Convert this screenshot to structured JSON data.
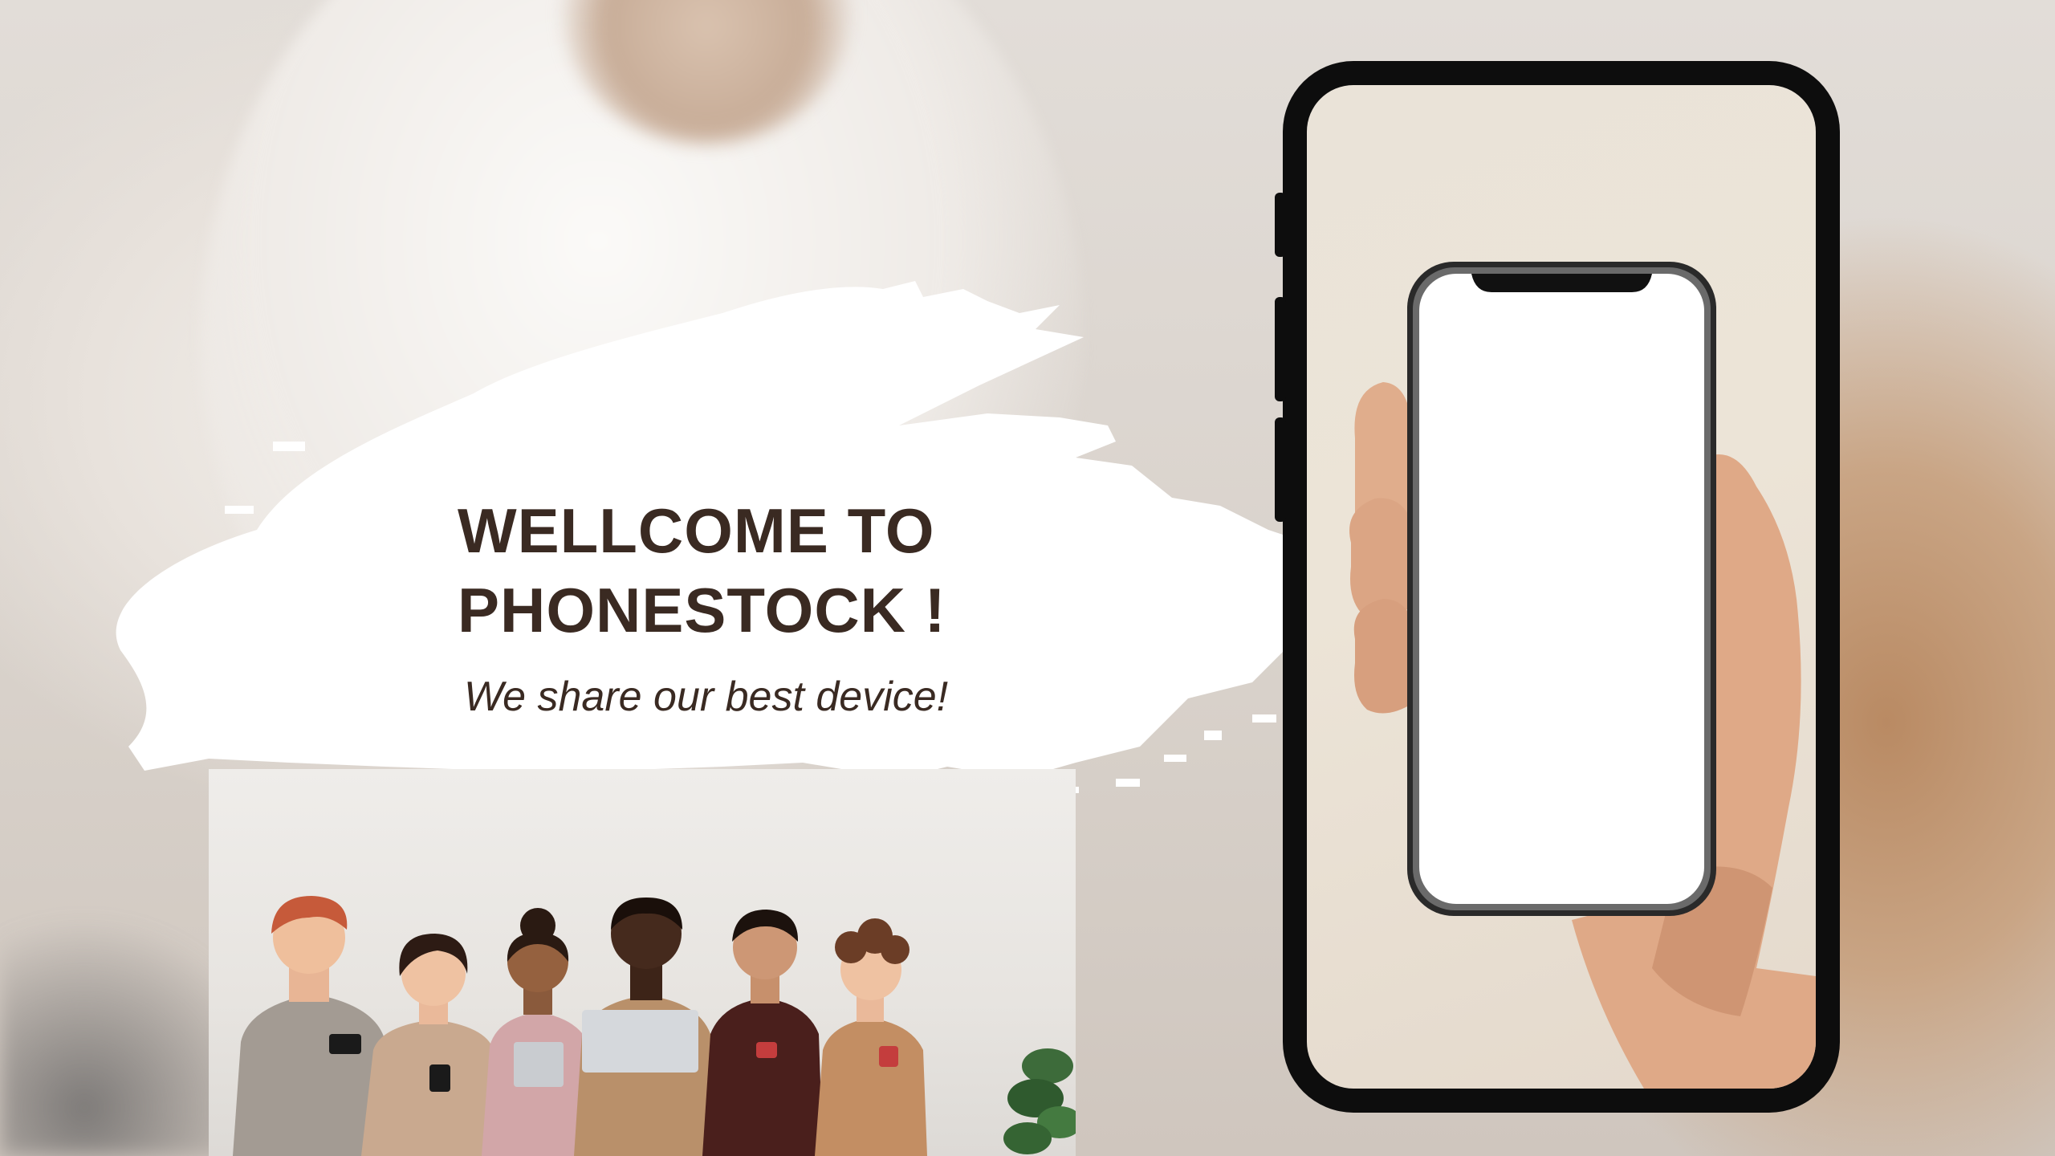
{
  "hero": {
    "title_line1": "WELLCOME TO",
    "title_line2": "PHONESTOCK !",
    "tagline": "We share our best device!"
  },
  "images": {
    "background": "blurred-person-using-phone-photo",
    "group_photo": "group-of-people-using-devices-photo",
    "phone_mockup": "hand-holding-smartphone-blank-screen"
  },
  "colors": {
    "title_text": "#3a2a22",
    "phone_frame": "#0d0d0d",
    "brush": "#ffffff",
    "screen_background": "#ece4d7"
  }
}
